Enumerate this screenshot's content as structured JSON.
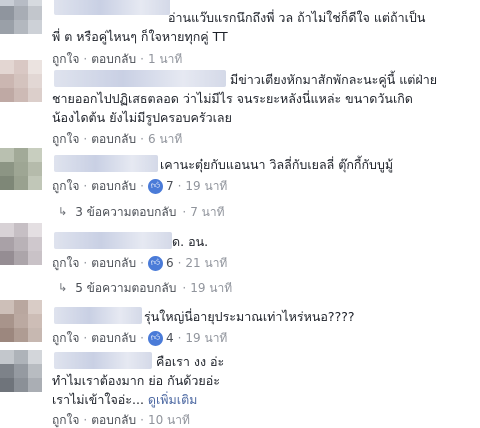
{
  "comments": [
    {
      "text": "อ่านแว๊บแรกนึกถึงพี่ วล ถ้าไม่ใช่ก็ดีใจ แต่ถ้าเป็น\nพี่ ต หรือคู่ไหนๆ ก็ใจหายทุกคู่ TT",
      "like": "ถูกใจ",
      "reply": "ตอบกลับ",
      "time": "1 นาที"
    },
    {
      "text": "มีข่าวเตียงหักมาสักพักละนะคู่นี้ แต่ฝ่าย\nชายออกไปปฏิเสธตลอด ว่าไม่มีไร จนระยะหลังนี่แหล่ะ ขนาดวันเกิด\nน้องไดต้น ยังไม่มีรูปครอบครัวเลย",
      "like": "ถูกใจ",
      "reply": "ตอบกลับ",
      "time": "6 นาที"
    },
    {
      "text": "เคานะตุ๋ยกับแอนนา วิลลี่กับเยลลี่ ตุ๊กกี้กับบูมู้",
      "like": "ถูกใจ",
      "reply": "ตอบกลับ",
      "reactions": "7",
      "time": "19 นาที",
      "replies": {
        "label": "3 ข้อความตอบกลับ",
        "time": "7 นาที"
      }
    },
    {
      "text": "ด. อน.",
      "like": "ถูกใจ",
      "reply": "ตอบกลับ",
      "reactions": "6",
      "time": "21 นาที",
      "replies": {
        "label": "5 ข้อความตอบกลับ",
        "time": "19 นาที"
      }
    },
    {
      "text": "รุ่นใหญ่นี่อายุประมาณเท่าไหร่หนอ????",
      "like": "ถูกใจ",
      "reply": "ตอบกลับ",
      "reactions": "4",
      "time": "19 นาที"
    },
    {
      "text": "คือเรา งง อ่ะ\nทำไมเราต้องมาก ย่อ กันด้วยอ่ะ\nเราไม่เข้าใจอ่ะ...",
      "see_more": "ดูเพิ่มเติม",
      "like": "ถูกใจ",
      "reply": "ตอบกลับ",
      "time": "10 นาที"
    }
  ],
  "separator": "·",
  "reply_arrow_icon": "reply-arrow-icon",
  "like_icon": "thumbs-up-icon",
  "colors": {
    "link": "#4b4f56",
    "meta": "#90949c",
    "like_badge": "#4a7bd8",
    "see_more": "#4b67a1"
  }
}
